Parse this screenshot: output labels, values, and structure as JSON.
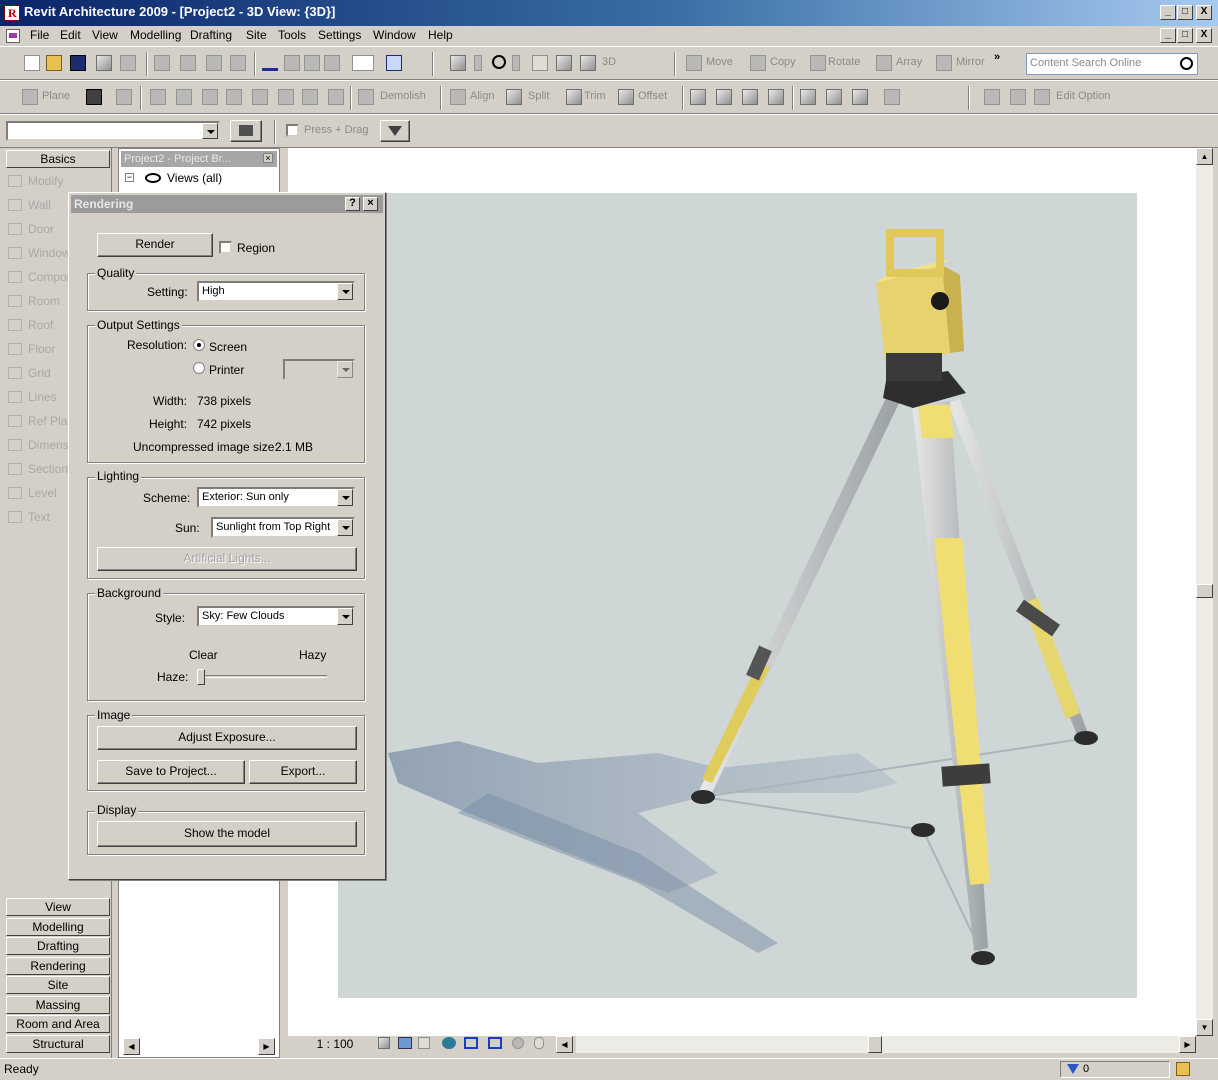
{
  "window": {
    "title": "Revit Architecture 2009 - [Project2 - 3D View: {3D}]",
    "controls": [
      "_",
      "□",
      "X"
    ]
  },
  "menu": [
    "File",
    "Edit",
    "View",
    "Modelling",
    "Drafting",
    "Site",
    "Tools",
    "Settings",
    "Window",
    "Help"
  ],
  "toolbar1": {
    "labels": [
      "3D",
      "Move",
      "Copy",
      "Rotate",
      "Array",
      "Mirror"
    ],
    "search_placeholder": "Content Search Online",
    "overflow": "»"
  },
  "toolbar2": {
    "labels": [
      "Plane",
      "Demolish",
      "Align",
      "Split",
      "Trim",
      "Offset",
      "Edit Option"
    ]
  },
  "toolbar3": {
    "press_drag": "Press + Drag"
  },
  "designbar": {
    "top_tab": "Basics",
    "items": [
      "Modify",
      "Wall",
      "Door",
      "Window",
      "Compon",
      "Room",
      "Roof",
      "Floor",
      "Grid",
      "Lines",
      "Ref Pla",
      "Dimensi",
      "Section",
      "Level",
      "Text"
    ],
    "bottom_tabs": [
      "View",
      "Modelling",
      "Drafting",
      "Rendering",
      "Site",
      "Massing",
      "Room and Area",
      "Structural"
    ]
  },
  "browser": {
    "header": "Project2 - Project Br...",
    "tree_root": "Views (all)"
  },
  "dialog": {
    "title": "Rendering",
    "render_button": "Render",
    "region_label": "Region",
    "quality": {
      "group": "Quality",
      "setting_label": "Setting:",
      "setting_value": "High"
    },
    "output": {
      "group": "Output Settings",
      "resolution_label": "Resolution:",
      "screen": "Screen",
      "printer": "Printer",
      "width_label": "Width:",
      "width_value": "738 pixels",
      "height_label": "Height:",
      "height_value": "742 pixels",
      "size_label": "Uncompressed image size:",
      "size_value": "2.1 MB"
    },
    "lighting": {
      "group": "Lighting",
      "scheme_label": "Scheme:",
      "scheme_value": "Exterior: Sun only",
      "sun_label": "Sun:",
      "sun_value": "Sunlight from Top Right",
      "artificial_button": "Artificial Lights..."
    },
    "background": {
      "group": "Background",
      "style_label": "Style:",
      "style_value": "Sky: Few Clouds",
      "clear": "Clear",
      "hazy": "Hazy",
      "haze_label": "Haze:",
      "haze_level": 0.0
    },
    "image": {
      "group": "Image",
      "adjust_button": "Adjust Exposure...",
      "save_button": "Save to Project...",
      "export_button": "Export..."
    },
    "display": {
      "group": "Display",
      "show_button": "Show the model"
    }
  },
  "viewcontrol": {
    "scale": "1 : 100"
  },
  "status": {
    "text": "Ready",
    "filter_count": "0"
  }
}
